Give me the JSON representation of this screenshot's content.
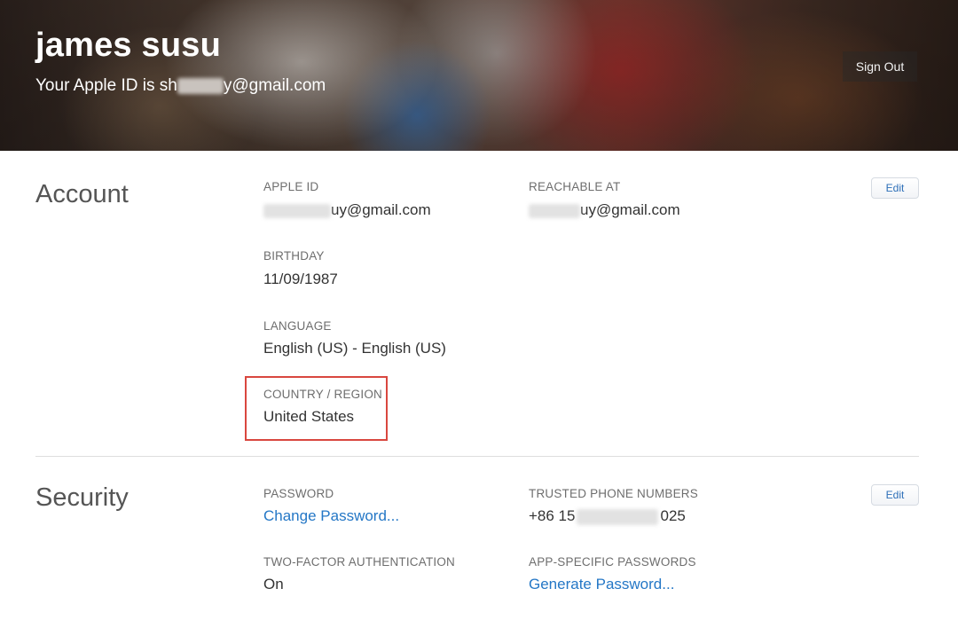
{
  "header": {
    "user_name": "james susu",
    "apple_id_prefix": "Your Apple ID is sh",
    "apple_id_suffix": "y@gmail.com",
    "sign_out_label": "Sign Out"
  },
  "account": {
    "title": "Account",
    "edit_label": "Edit",
    "apple_id": {
      "label": "APPLE ID",
      "value_suffix": "uy@gmail.com"
    },
    "reachable_at": {
      "label": "REACHABLE AT",
      "value_suffix": "uy@gmail.com"
    },
    "birthday": {
      "label": "BIRTHDAY",
      "value": "11/09/1987"
    },
    "language": {
      "label": "LANGUAGE",
      "value": "English (US) - English (US)"
    },
    "country_region": {
      "label": "COUNTRY / REGION",
      "value": "United States"
    }
  },
  "security": {
    "title": "Security",
    "edit_label": "Edit",
    "password": {
      "label": "PASSWORD",
      "link": "Change Password..."
    },
    "trusted_phone_numbers": {
      "label": "TRUSTED PHONE NUMBERS",
      "value_prefix": "+86 15",
      "value_suffix": "025"
    },
    "two_factor": {
      "label": "TWO-FACTOR AUTHENTICATION",
      "value": "On"
    },
    "app_specific_passwords": {
      "label": "APP-SPECIFIC PASSWORDS",
      "link": "Generate Password..."
    }
  },
  "colors": {
    "link": "#2477c6",
    "highlight": "#d9473f",
    "edit_text": "#2d6fb8"
  }
}
